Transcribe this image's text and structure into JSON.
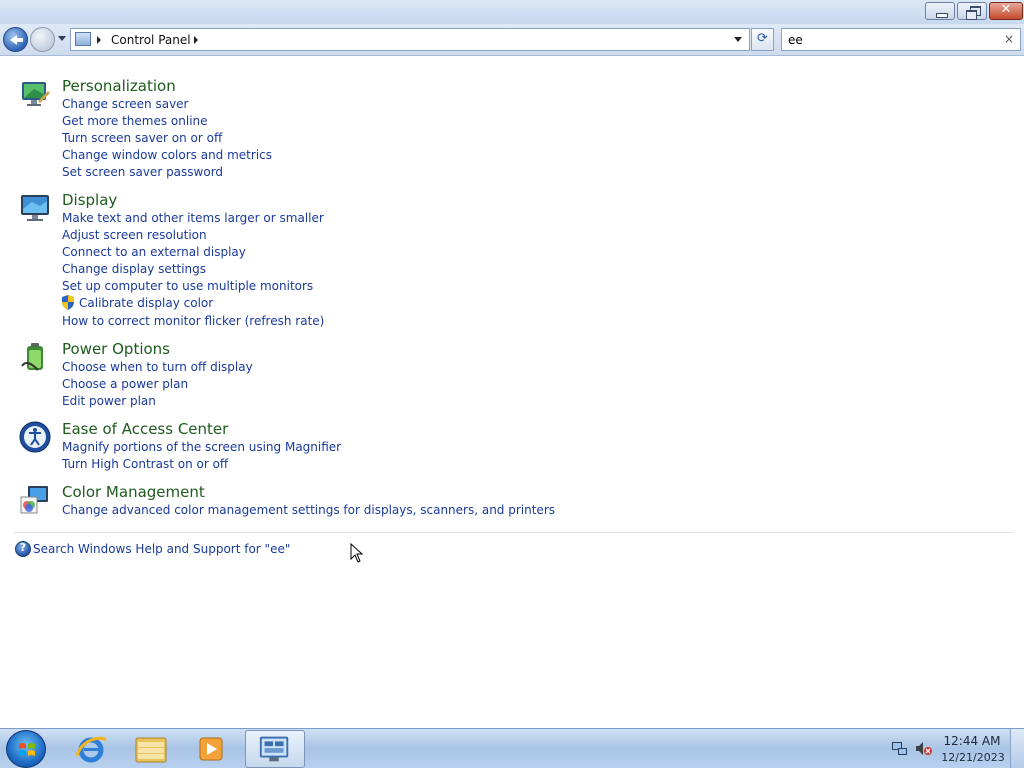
{
  "window": {
    "close_glyph": "✕",
    "minimize_label": "",
    "maximize_label": ""
  },
  "address_bar": {
    "breadcrumb": "Control Panel",
    "refresh_glyph": "⟳"
  },
  "search": {
    "value": "ee",
    "clear_glyph": "×"
  },
  "results": [
    {
      "title": "Personalization",
      "icon": "personalization-icon",
      "tasks": [
        "Change screen saver",
        "Get more themes online",
        "Turn screen saver on or off",
        "Change window colors and metrics",
        "Set screen saver password"
      ]
    },
    {
      "title": "Display",
      "icon": "display-icon",
      "tasks": [
        "Make text and other items larger or smaller",
        "Adjust screen resolution",
        "Connect to an external display",
        "Change display settings",
        "Set up computer to use multiple monitors",
        "Calibrate display color",
        "How to correct monitor flicker (refresh rate)"
      ]
    },
    {
      "title": "Power Options",
      "icon": "power-options-icon",
      "tasks": [
        "Choose when to turn off display",
        "Choose a power plan",
        "Edit power plan"
      ]
    },
    {
      "title": "Ease of Access Center",
      "icon": "ease-of-access-icon",
      "tasks": [
        "Magnify portions of the screen using Magnifier",
        "Turn High Contrast on or off"
      ]
    },
    {
      "title": "Color Management",
      "icon": "color-management-icon",
      "tasks": [
        "Change advanced color management settings for displays, scanners, and printers"
      ]
    }
  ],
  "help_link": "Search Windows Help and Support for \"ee\"",
  "help_glyph": "?",
  "taskbar": {
    "apps": [
      "internet-explorer-icon",
      "windows-explorer-icon",
      "media-player-icon",
      "control-panel-icon"
    ],
    "clock_time": "12:44 AM",
    "clock_date": "12/21/2023"
  },
  "colors": {
    "category_title": "#1e5b1e",
    "task_link": "#1a3a9c"
  }
}
